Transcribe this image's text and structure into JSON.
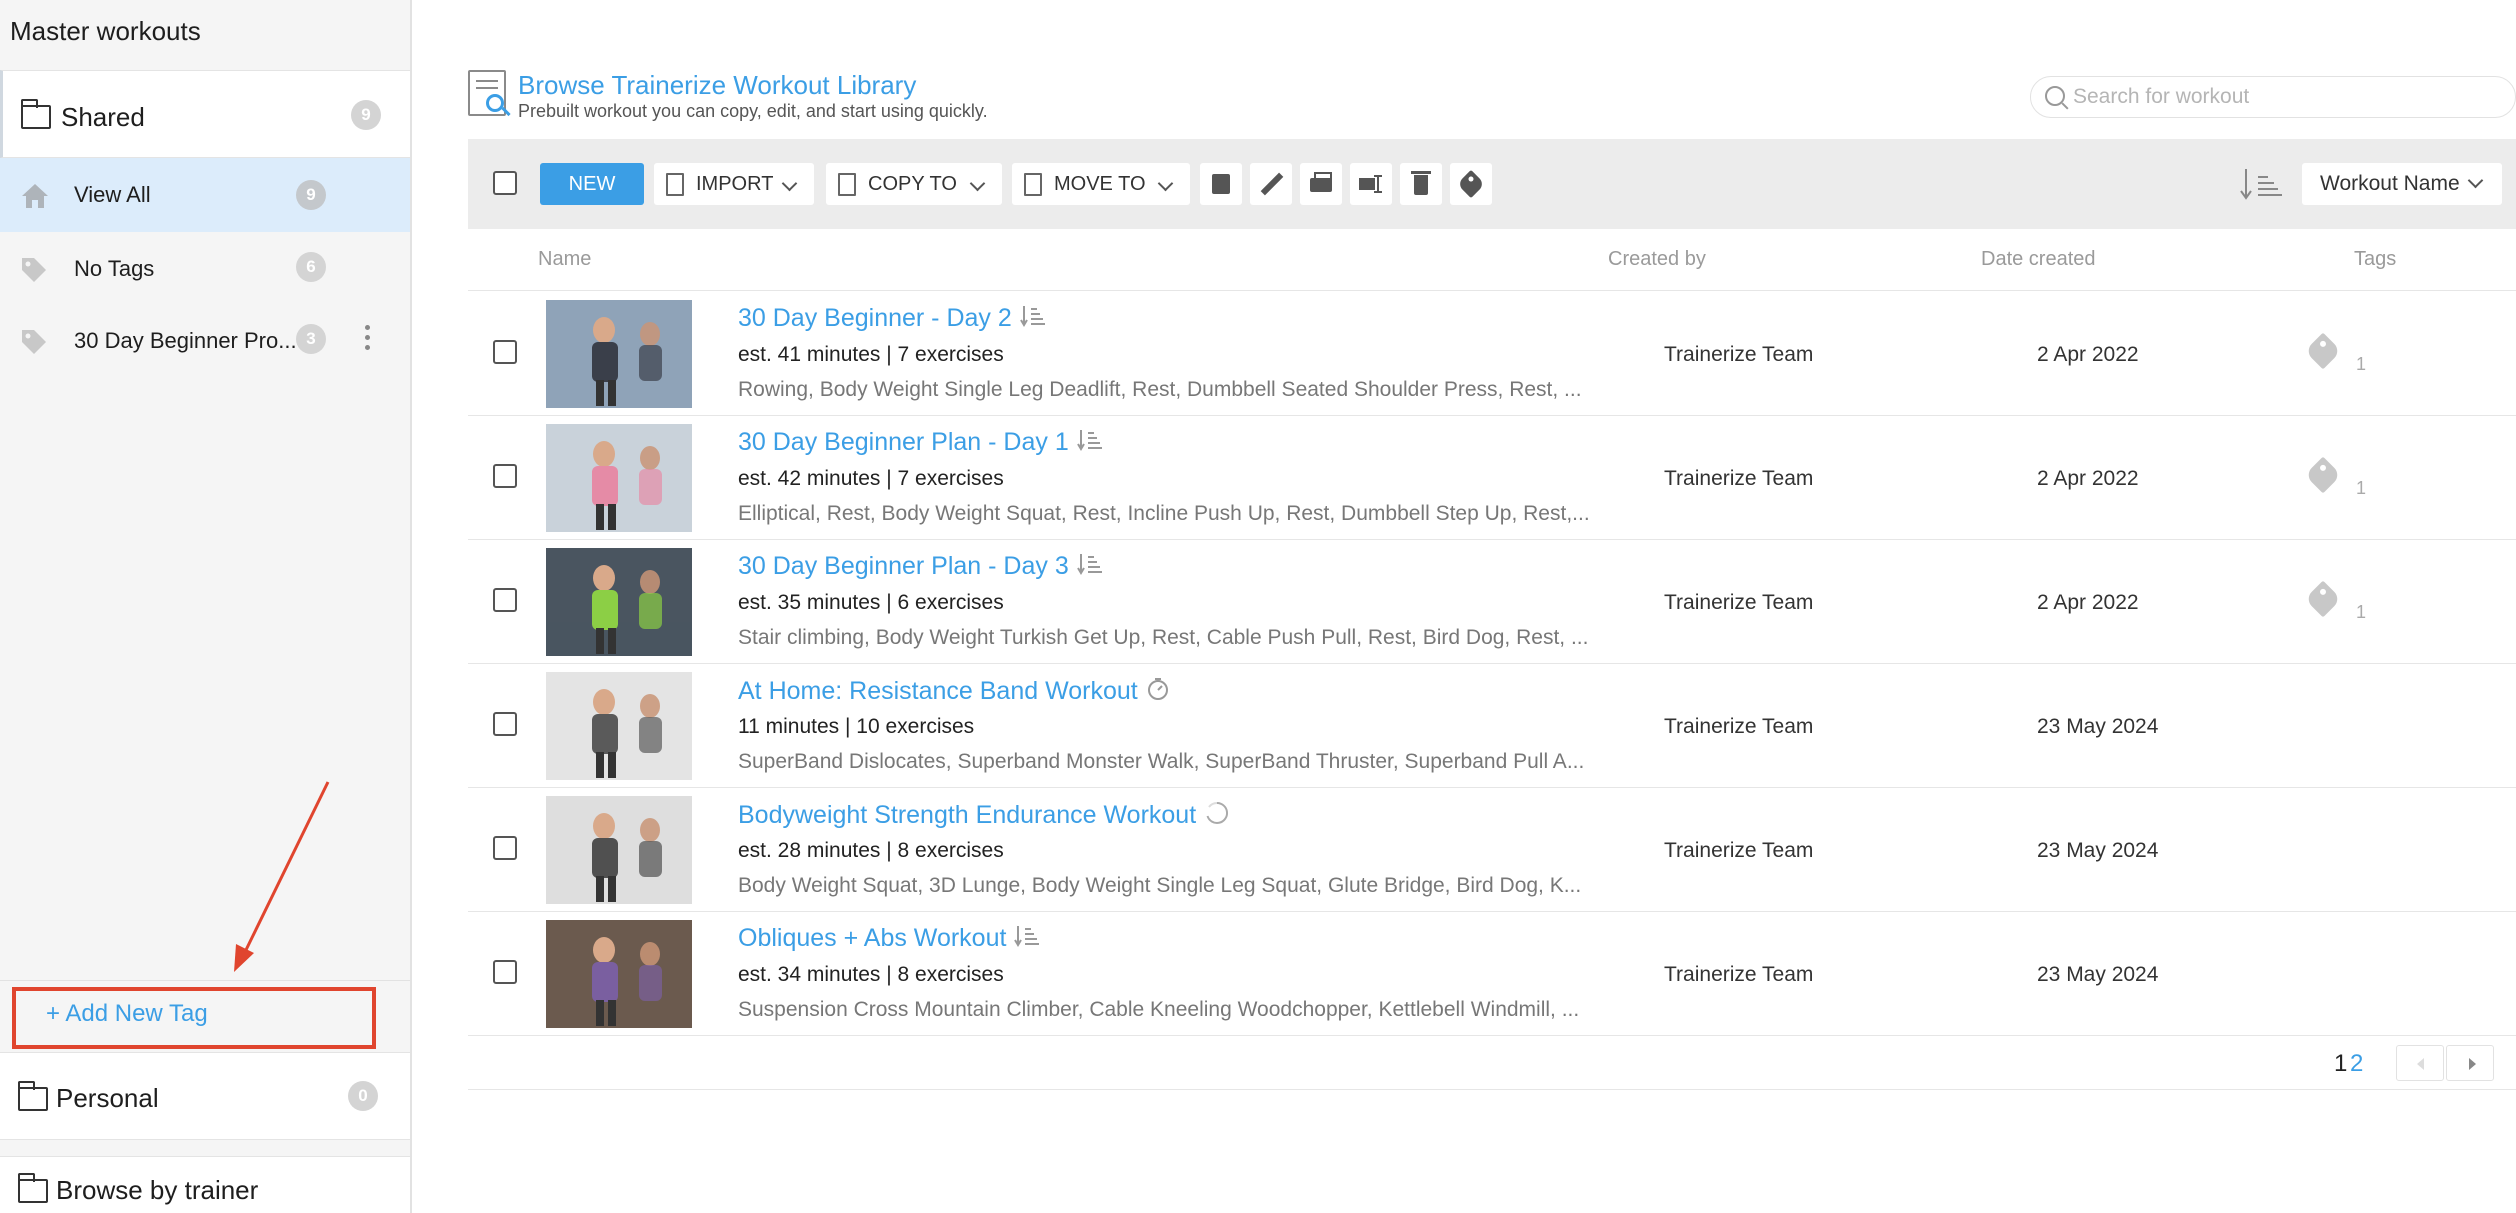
{
  "sidebar": {
    "title": "Master workouts",
    "shared": {
      "label": "Shared",
      "count": "9"
    },
    "items": [
      {
        "label": "View All",
        "count": "9",
        "icon": "home-icon"
      },
      {
        "label": "No Tags",
        "count": "6",
        "icon": "tag-icon"
      },
      {
        "label": "30 Day Beginner Pro...",
        "count": "3",
        "icon": "tag-icon"
      }
    ],
    "add_tag_label": "+ Add New Tag",
    "personal": {
      "label": "Personal",
      "count": "0"
    },
    "browse_label": "Browse by trainer"
  },
  "header": {
    "title": "Browse Trainerize Workout Library",
    "subtitle": "Prebuilt workout you can copy, edit, and start using quickly.",
    "search_placeholder": "Search for workout"
  },
  "toolbar": {
    "new_label": "NEW",
    "import_label": "IMPORT",
    "copy_label": "COPY TO",
    "move_label": "MOVE TO",
    "sort_value": "Workout Name"
  },
  "columns": {
    "name": "Name",
    "created_by": "Created by",
    "date_created": "Date created",
    "tags": "Tags"
  },
  "workouts": [
    {
      "name": "30 Day Beginner - Day 2",
      "type_icon": "list-sort-icon",
      "meta": "est. 41 minutes | 7 exercises",
      "exercises": "Rowing, Body Weight Single Leg Deadlift, Rest, Dumbbell Seated Shoulder Press, Rest, ...",
      "creator": "Trainerize Team",
      "date": "2 Apr 2022",
      "tags": "1",
      "thumb_colors": [
        "#8fa3b8",
        "#3a3f4a"
      ]
    },
    {
      "name": "30 Day Beginner Plan - Day 1",
      "type_icon": "list-sort-icon",
      "meta": "est. 42 minutes | 7 exercises",
      "exercises": "Elliptical, Rest, Body Weight Squat, Rest, Incline Push Up, Rest, Dumbbell Step Up, Rest,...",
      "creator": "Trainerize Team",
      "date": "2 Apr 2022",
      "tags": "1",
      "thumb_colors": [
        "#c9d2da",
        "#e58ba6"
      ]
    },
    {
      "name": "30 Day Beginner Plan - Day 3",
      "type_icon": "list-sort-icon",
      "meta": "est. 35 minutes | 6 exercises",
      "exercises": "Stair climbing, Body Weight Turkish Get Up, Rest, Cable Push Pull, Rest, Bird Dog, Rest, ...",
      "creator": "Trainerize Team",
      "date": "2 Apr 2022",
      "tags": "1",
      "thumb_colors": [
        "#4a5560",
        "#8ccf45"
      ]
    },
    {
      "name": "At Home: Resistance Band Workout",
      "type_icon": "timer-icon",
      "meta": "11 minutes | 10 exercises",
      "exercises": "SuperBand Dislocates, Superband Monster Walk, SuperBand Thruster, Superband Pull A...",
      "creator": "Trainerize Team",
      "date": "23 May 2024",
      "tags": "",
      "thumb_colors": [
        "#e4e4e4",
        "#5a5a5a"
      ]
    },
    {
      "name": "Bodyweight Strength Endurance Workout",
      "type_icon": "circuit-icon",
      "meta": "est. 28 minutes | 8 exercises",
      "exercises": "Body Weight Squat, 3D Lunge, Body Weight Single Leg Squat, Glute Bridge, Bird Dog, K...",
      "creator": "Trainerize Team",
      "date": "23 May 2024",
      "tags": "",
      "thumb_colors": [
        "#dedede",
        "#505050"
      ]
    },
    {
      "name": "Obliques + Abs Workout",
      "type_icon": "list-sort-icon",
      "meta": "est. 34 minutes | 8 exercises",
      "exercises": "Suspension Cross Mountain Climber, Cable Kneeling Woodchopper, Kettlebell Windmill, ...",
      "creator": "Trainerize Team",
      "date": "23 May 2024",
      "tags": "",
      "thumb_colors": [
        "#6b5a4e",
        "#7a5fa0"
      ]
    }
  ],
  "pagination": {
    "page1": "1",
    "page2": "2"
  },
  "colors": {
    "accent": "#3b9ee5",
    "annotation": "#e0452e",
    "selected_bg": "#dcecfb"
  }
}
